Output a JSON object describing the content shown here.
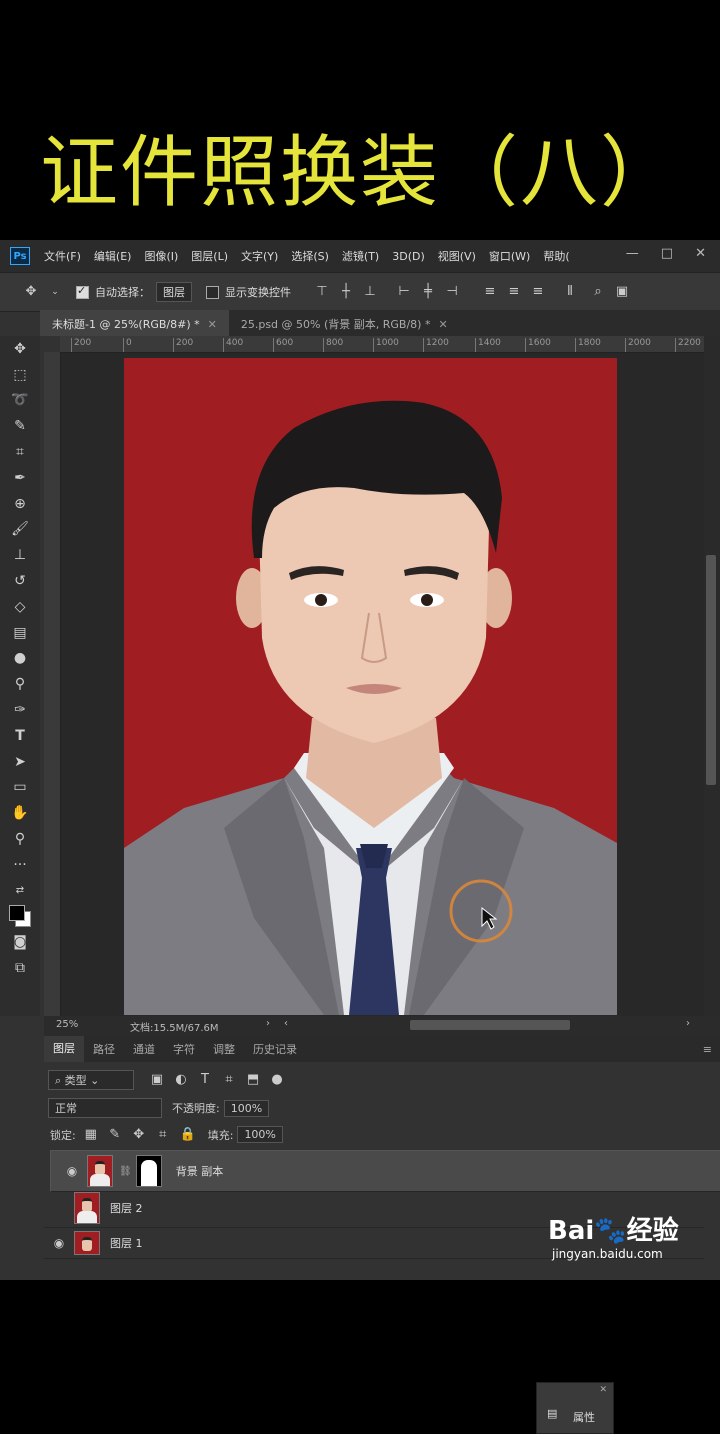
{
  "video_title": "证件照换装（八）",
  "app": {
    "logo": "Ps",
    "menu": [
      "文件(F)",
      "编辑(E)",
      "图像(I)",
      "图层(L)",
      "文字(Y)",
      "选择(S)",
      "滤镜(T)",
      "3D(D)",
      "视图(V)",
      "窗口(W)",
      "帮助("
    ],
    "window_controls": [
      "—",
      "□",
      "✕"
    ]
  },
  "options_bar": {
    "auto_select_label": "自动选择：",
    "auto_select_value": "图层",
    "show_transform_label": "显示变换控件"
  },
  "tabs": [
    {
      "label": "未标题-1 @ 25%(RGB/8#) *",
      "active": true
    },
    {
      "label": "25.psd @ 50% (背景 副本, RGB/8) *",
      "active": false
    }
  ],
  "ruler_top": [
    "200",
    "0",
    "200",
    "400",
    "600",
    "800",
    "1000",
    "1200",
    "1400",
    "1600",
    "1800",
    "2000",
    "2200"
  ],
  "status": {
    "zoom": "25%",
    "doc": "文档:15.5M/67.6M"
  },
  "layers_panel": {
    "tabs": [
      "图层",
      "路径",
      "通道",
      "字符",
      "调整",
      "历史记录"
    ],
    "filter_label": "类型",
    "blend_mode": "正常",
    "opacity_label": "不透明度:",
    "opacity_value": "100%",
    "lock_label": "锁定:",
    "fill_label": "填充:",
    "fill_value": "100%",
    "layers": [
      {
        "name": "背景 副本",
        "visible": true,
        "selected": true,
        "has_mask": true
      },
      {
        "name": "图层 2",
        "visible": false,
        "selected": false,
        "has_mask": false
      },
      {
        "name": "图层 1",
        "visible": true,
        "selected": false,
        "has_mask": false
      }
    ]
  },
  "properties_panel": {
    "label": "属性"
  },
  "watermark": {
    "brand": "Bai",
    "brand2": "经验",
    "url": "jingyan.baidu.com"
  },
  "colors": {
    "canvas_bg": "#a01d22",
    "title": "#e4e43a",
    "suit": "#7d7c82",
    "tie": "#2c3660"
  }
}
